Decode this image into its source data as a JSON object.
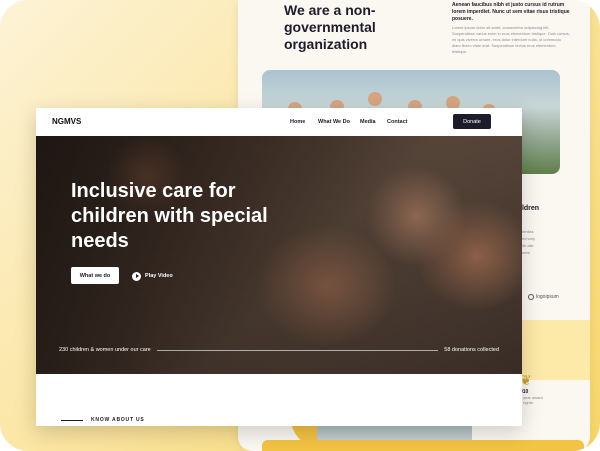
{
  "back_page": {
    "title": "We are a non-governmental organization",
    "intro_bold": "Aenean faucibus nibh et justo cursus id rutrum lorem imperdiet. Nunc ut sem vitae risus tristique posuere.",
    "intro_text": "Lorem ipsum dolor sit amet, consectetur adipiscing elit. Suspendisse varius enim in eros elementum tristique. Duis cursus, mi quis viverra ornare, eros dolor interdum nulla, ut commodo diam libero vitae erat. Suspendisse lectus eros elementum tristique.",
    "right_heading": "ildren",
    "right_text": "plentiss sed vary alle alle lorem",
    "logo_text": "logoipsum",
    "award_number": "010",
    "award_sub": "s year award",
    "award_sub2": "s rights"
  },
  "nav": {
    "brand": "NGMVS",
    "links": [
      "Home",
      "What We Do",
      "Media",
      "Contact"
    ],
    "donate_label": "Donate"
  },
  "hero": {
    "title": "Inclusive care for children with special needs",
    "primary_button": "What we do",
    "secondary_button": "Play Video",
    "stat_left": "230 children & women under our care",
    "stat_right": "58 donations collected"
  },
  "section": {
    "eyebrow": "KNOW ABOUT US"
  },
  "colors": {
    "accent_yellow": "#f3c344",
    "dark": "#1c1c2a"
  }
}
